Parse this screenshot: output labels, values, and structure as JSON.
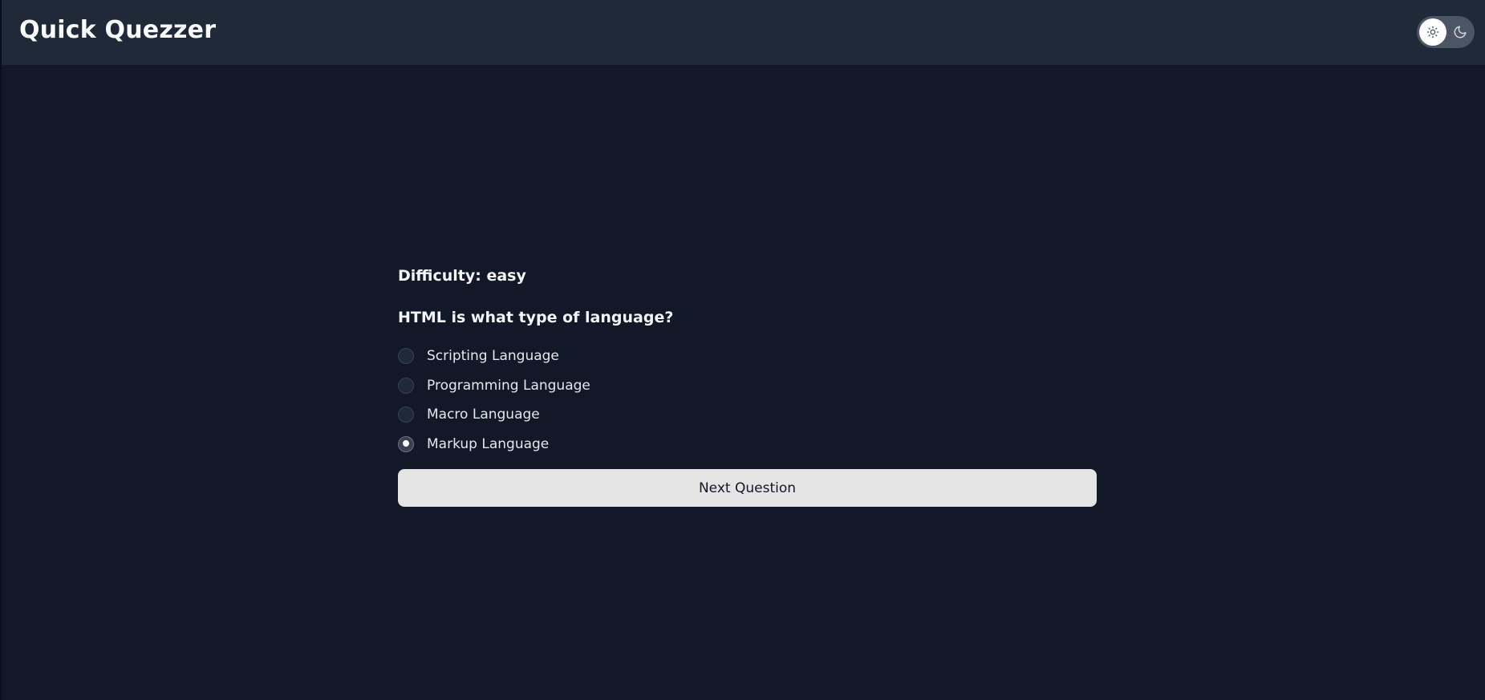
{
  "header": {
    "title": "Quick Quezzer",
    "theme_toggle": {
      "light_icon": "sun-icon",
      "dark_icon": "moon-icon",
      "selected": "light"
    }
  },
  "quiz": {
    "difficulty": "Difficulty: easy",
    "question": "HTML is what type of language?",
    "options": [
      {
        "label": "Scripting Language",
        "selected": false
      },
      {
        "label": "Programming Language",
        "selected": false
      },
      {
        "label": "Macro Language",
        "selected": false
      },
      {
        "label": "Markup Language",
        "selected": true
      }
    ],
    "next_label": "Next Question"
  },
  "colors": {
    "background": "#111827",
    "header": "#1f2937",
    "button": "#e5e5e5",
    "text": "#f3f4f6"
  }
}
